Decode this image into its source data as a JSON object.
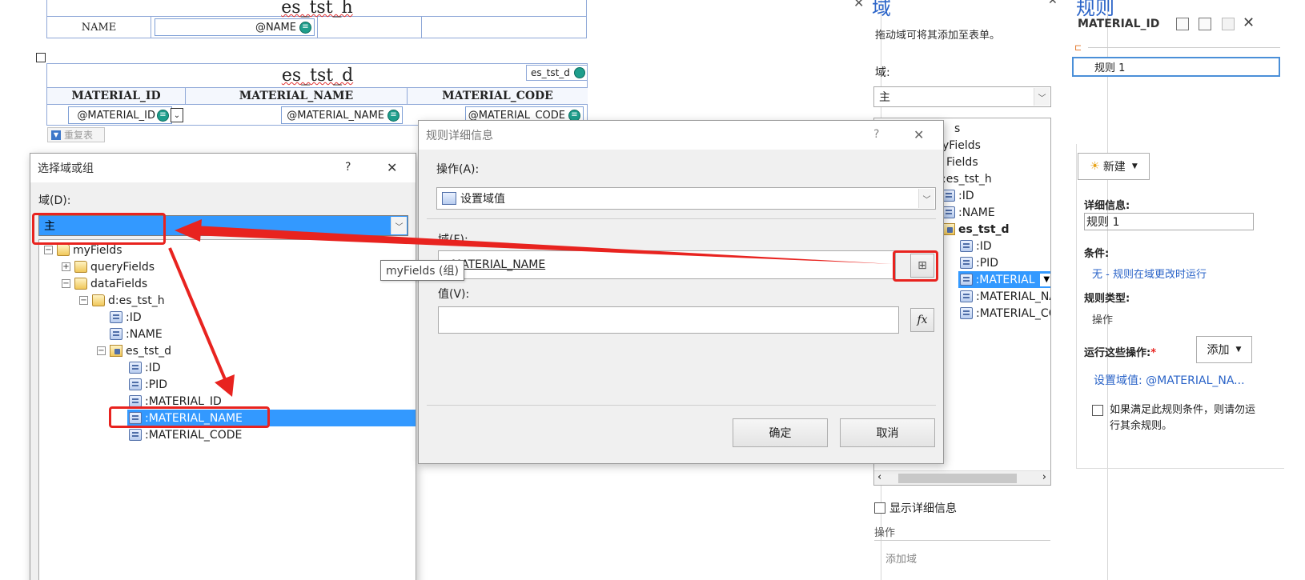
{
  "form": {
    "header_title": "es_tst_h",
    "name_label": "NAME",
    "name_control": "@NAME",
    "detail_title": "es_tst_d",
    "detail_tag": "es_tst_d",
    "col_headers": [
      "MATERIAL_ID",
      "MATERIAL_NAME",
      "MATERIAL_CODE"
    ],
    "col_controls": [
      "@MATERIAL_ID",
      "@MATERIAL_NAME",
      "@MATERIAL_CODE"
    ],
    "repeat_label": "重复表"
  },
  "domain_pane": {
    "title": "域",
    "hint": "拖动域可将其添加至表单。",
    "domain_label": "域:",
    "domain_value": "主",
    "tree": [
      "s",
      "yFields",
      "Fields",
      ":es_tst_h",
      ":ID",
      ":NAME",
      "es_tst_d",
      ":ID",
      ":PID",
      ":MATERIAL",
      ":MATERIAL_NA",
      ":MATERIAL_CO"
    ],
    "show_details": "显示详细信息",
    "actions_label": "操作",
    "add_field": "添加域"
  },
  "rules_pane": {
    "title": "规则",
    "field_name": "MATERIAL_ID",
    "rule_item": "规则 1",
    "new_button": "新建",
    "details_label": "详细信息:",
    "details_value": "规则 1",
    "condition_label": "条件:",
    "condition_value": "无 - 规则在域更改时运行",
    "rule_type_label": "规则类型:",
    "rule_type_value": "操作",
    "run_actions_label": "运行这些操作:",
    "required_mark": "*",
    "add_button": "添加",
    "action_link": "设置域值: @MATERIAL_NA...",
    "checkbox_text": "如果满足此规则条件，则请勿运行其余规则。"
  },
  "select_dialog": {
    "title": "选择域或组",
    "help": "?",
    "close": "✕",
    "domain_label": "域(D):",
    "domain_value": "主",
    "tree": [
      {
        "label": "myFields",
        "expander": "⊟"
      },
      {
        "label": "queryFields",
        "expander": "⊞"
      },
      {
        "label": "dataFields",
        "expander": "⊟"
      },
      {
        "label": "d:es_tst_h",
        "expander": "⊟"
      },
      {
        "label": ":ID"
      },
      {
        "label": ":NAME"
      },
      {
        "label": "es_tst_d",
        "expander": "⊟"
      },
      {
        "label": ":ID"
      },
      {
        "label": ":PID"
      },
      {
        "label": ":MATERIAL_ID"
      },
      {
        "label": ":MATERIAL_NAME"
      },
      {
        "label": ":MATERIAL_CODE"
      }
    ]
  },
  "rule_dialog": {
    "title": "规则详细信息",
    "help": "?",
    "close": "✕",
    "action_label": "操作(A):",
    "action_value": "设置域值",
    "field_label": "域(F):",
    "field_value": "@MATERIAL_NAME",
    "value_label": "值(V):",
    "value_value": "",
    "fx": "fx",
    "ok": "确定",
    "cancel": "取消"
  },
  "tooltip": "myFields (组)",
  "colors": {
    "annotation_red": "#e8231f",
    "selection_blue": "#3399ff",
    "link_blue": "#2b64c8",
    "form_border": "#8fa8d8"
  }
}
